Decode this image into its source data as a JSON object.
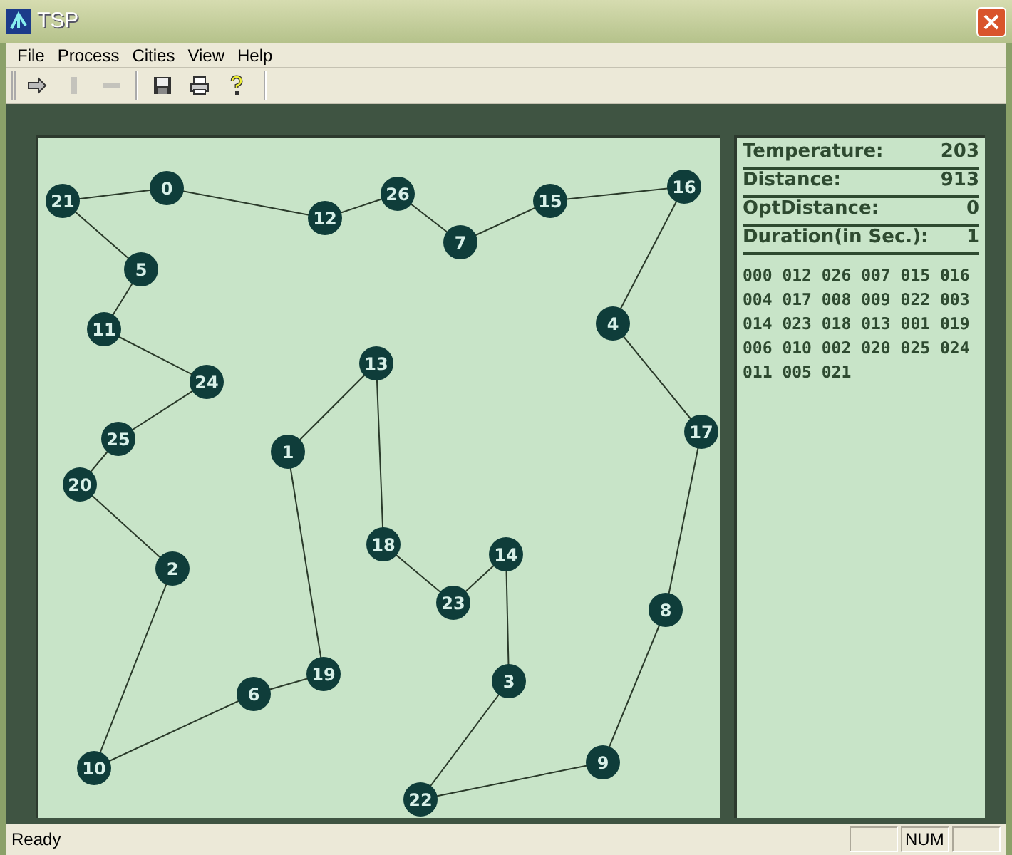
{
  "window": {
    "title": "TSP"
  },
  "menu": [
    "File",
    "Process",
    "Cities",
    "View",
    "Help"
  ],
  "toolbar": [
    {
      "kind": "arrow",
      "disabled": false
    },
    {
      "kind": "pause",
      "disabled": true
    },
    {
      "kind": "stop",
      "disabled": true
    },
    {
      "kind": "save",
      "disabled": false
    },
    {
      "kind": "print",
      "disabled": false
    },
    {
      "kind": "help",
      "disabled": false
    }
  ],
  "cities": [
    {
      "label": "0"
    },
    {
      "label": "12"
    },
    {
      "label": "26"
    },
    {
      "label": "7"
    },
    {
      "label": "15"
    },
    {
      "label": "16"
    },
    {
      "label": "4"
    },
    {
      "label": "17"
    },
    {
      "label": "8"
    },
    {
      "label": "9"
    },
    {
      "label": "22"
    },
    {
      "label": "3"
    },
    {
      "label": "14"
    },
    {
      "label": "23"
    },
    {
      "label": "18"
    },
    {
      "label": "13"
    },
    {
      "label": "1"
    },
    {
      "label": "19"
    },
    {
      "label": "6"
    },
    {
      "label": "10"
    },
    {
      "label": "2"
    },
    {
      "label": "20"
    },
    {
      "label": "25"
    },
    {
      "label": "24"
    },
    {
      "label": "11"
    },
    {
      "label": "5"
    },
    {
      "label": "21"
    }
  ],
  "stats": [
    {
      "label": "Temperature:",
      "value": "203"
    },
    {
      "label": "Distance:",
      "value": "913"
    },
    {
      "label": "OptDistance:",
      "value": "0"
    },
    {
      "label": "Duration(in Sec.):",
      "value": "1"
    }
  ],
  "route_lines": [
    "000 012 026 007 015 016",
    "004 017 008 009 022 003",
    "014 023 018 013 001 019",
    "006 010 002 020 025 024",
    "011 005 021"
  ],
  "status_bar": {
    "text": "Ready",
    "num_indicator": "NUM"
  }
}
